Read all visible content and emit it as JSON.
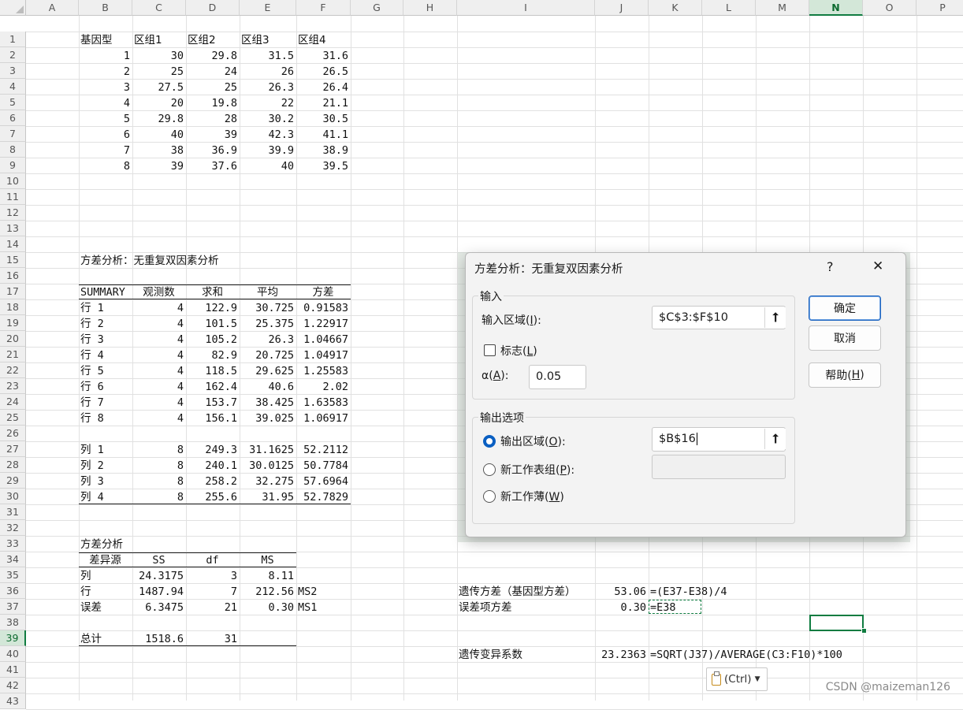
{
  "columns": [
    "A",
    "B",
    "C",
    "D",
    "E",
    "F",
    "G",
    "H",
    "I",
    "J",
    "K",
    "L",
    "M",
    "N",
    "O",
    "P"
  ],
  "rows": [
    "1",
    "2",
    "3",
    "4",
    "5",
    "6",
    "7",
    "8",
    "9",
    "10",
    "11",
    "12",
    "13",
    "14",
    "15",
    "16",
    "17",
    "18",
    "19",
    "20",
    "21",
    "22",
    "23",
    "24",
    "25",
    "26",
    "27",
    "28",
    "29",
    "30",
    "31",
    "32",
    "33",
    "34",
    "35",
    "36",
    "37",
    "38",
    "39",
    "40",
    "41",
    "42",
    "43"
  ],
  "active_column": "N",
  "active_row": "39",
  "data_table": {
    "headers": [
      "基因型",
      "区组1",
      "区组2",
      "区组3",
      "区组4"
    ],
    "rows": [
      [
        "1",
        "30",
        "29.8",
        "31.5",
        "31.6"
      ],
      [
        "2",
        "25",
        "24",
        "26",
        "26.5"
      ],
      [
        "3",
        "27.5",
        "25",
        "26.3",
        "26.4"
      ],
      [
        "4",
        "20",
        "19.8",
        "22",
        "21.1"
      ],
      [
        "5",
        "29.8",
        "28",
        "30.2",
        "30.5"
      ],
      [
        "6",
        "40",
        "39",
        "42.3",
        "41.1"
      ],
      [
        "7",
        "38",
        "36.9",
        "39.9",
        "38.9"
      ],
      [
        "8",
        "39",
        "37.6",
        "40",
        "39.5"
      ]
    ]
  },
  "anova_title": "方差分析：无重复双因素分析",
  "summary": {
    "headers": [
      "SUMMARY",
      "观测数",
      "求和",
      "平均",
      "方差"
    ],
    "rows": [
      [
        "行 1",
        "4",
        "122.9",
        "30.725",
        "0.91583"
      ],
      [
        "行 2",
        "4",
        "101.5",
        "25.375",
        "1.22917"
      ],
      [
        "行 3",
        "4",
        "105.2",
        "26.3",
        "1.04667"
      ],
      [
        "行 4",
        "4",
        "82.9",
        "20.725",
        "1.04917"
      ],
      [
        "行 5",
        "4",
        "118.5",
        "29.625",
        "1.25583"
      ],
      [
        "行 6",
        "4",
        "162.4",
        "40.6",
        "2.02"
      ],
      [
        "行 7",
        "4",
        "153.7",
        "38.425",
        "1.63583"
      ],
      [
        "行 8",
        "4",
        "156.1",
        "39.025",
        "1.06917"
      ]
    ],
    "col_rows": [
      [
        "列 1",
        "8",
        "249.3",
        "31.1625",
        "52.2112"
      ],
      [
        "列 2",
        "8",
        "240.1",
        "30.0125",
        "50.7784"
      ],
      [
        "列 3",
        "8",
        "258.2",
        "32.275",
        "57.6964"
      ],
      [
        "列 4",
        "8",
        "255.6",
        "31.95",
        "52.7829"
      ]
    ]
  },
  "anova": {
    "title": "方差分析",
    "headers": [
      "差异源",
      "SS",
      "df",
      "MS"
    ],
    "rows": [
      [
        "列",
        "24.3175",
        "3",
        "8.11",
        ""
      ],
      [
        "行",
        "1487.94",
        "7",
        "212.56",
        "MS2"
      ],
      [
        "误差",
        "6.3475",
        "21",
        "0.30",
        "MS1"
      ]
    ],
    "total": [
      "总计",
      "1518.6",
      "31"
    ]
  },
  "results": [
    {
      "label": "遗传方差（基因型方差）",
      "value": "53.06",
      "formula": "=(E37-E38)/4"
    },
    {
      "label": "误差项方差",
      "value": "0.30",
      "formula": "=E38"
    },
    {
      "label": "遗传变异系数",
      "value": "23.2363",
      "formula": "=SQRT(J37)/AVERAGE(C3:F10)*100"
    }
  ],
  "dialog": {
    "title": "方差分析：无重复双因素分析",
    "help_glyph": "?",
    "close_glyph": "✕",
    "input_group": "输入",
    "input_range_label": "输入区域(",
    "input_range_key": "I",
    "input_range_label_end": "):",
    "input_range_value": "$C$3:$F$10",
    "labels_label": "标志(",
    "labels_key": "L",
    "labels_end": ")",
    "labels_checked": false,
    "alpha_label": "α(",
    "alpha_key": "A",
    "alpha_end": "):",
    "alpha_value": "0.05",
    "output_group": "输出选项",
    "output_range_label": "输出区域(",
    "output_range_key": "O",
    "output_range_end": "):",
    "output_range_value": "$B$16",
    "new_sheet_label": "新工作表组(",
    "new_sheet_key": "P",
    "new_sheet_end": "):",
    "new_book_label": "新工作薄(",
    "new_book_key": "W",
    "new_book_end": ")",
    "selected_output": "output_range",
    "ok_label": "确定",
    "cancel_label": "取消",
    "help_label": "帮助(",
    "help_key": "H",
    "help_end": ")"
  },
  "paste_options": {
    "label": "(Ctrl)",
    "icon": "clipboard-icon"
  },
  "watermark": "CSDN @maizeman126",
  "colors": {
    "accent": "#107c41",
    "dialog_accent": "#0a5fc2",
    "header_bg": "#efefef"
  }
}
